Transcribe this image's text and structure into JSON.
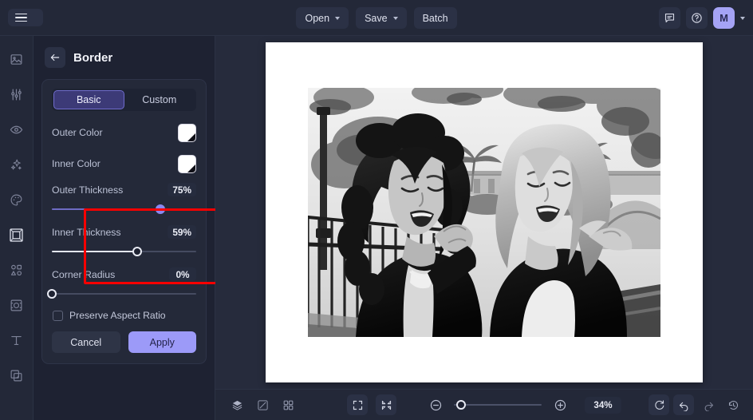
{
  "app": {
    "title": "Photo Editor",
    "accent": "#9c9af8",
    "panel_bg": "#1e2232",
    "annotation_color": "#f60000"
  },
  "topbar": {
    "menu_icon": "hamburger-icon",
    "open_label": "Open",
    "save_label": "Save",
    "batch_label": "Batch",
    "comment_icon": "comment-icon",
    "help_icon": "help-circle-icon",
    "avatar_initial": "M"
  },
  "sidebar": {
    "items": [
      {
        "name": "image",
        "icon": "image-icon",
        "active": false
      },
      {
        "name": "adjust",
        "icon": "sliders-icon",
        "active": false
      },
      {
        "name": "retouch",
        "icon": "eye-icon",
        "active": false
      },
      {
        "name": "effects",
        "icon": "sparkles-icon",
        "active": false
      },
      {
        "name": "color",
        "icon": "palette-icon",
        "active": false
      },
      {
        "name": "border",
        "icon": "border-icon",
        "active": true
      },
      {
        "name": "shapes",
        "icon": "shapes-icon",
        "active": false
      },
      {
        "name": "crop",
        "icon": "frame-icon",
        "active": false
      },
      {
        "name": "text",
        "icon": "text-icon",
        "active": false
      },
      {
        "name": "layers",
        "icon": "layers-copy-icon",
        "active": false
      }
    ]
  },
  "panel": {
    "back_icon": "arrow-left-icon",
    "title": "Border",
    "tabs": [
      {
        "label": "Basic",
        "active": true
      },
      {
        "label": "Custom",
        "active": false
      }
    ],
    "outer_color": {
      "label": "Outer Color",
      "value": "#ffffff"
    },
    "inner_color": {
      "label": "Inner Color",
      "value": "#ffffff"
    },
    "outer_thickness": {
      "label": "Outer Thickness",
      "value": 75,
      "display": "75%"
    },
    "inner_thickness": {
      "label": "Inner Thickness",
      "value": 59,
      "display": "59%"
    },
    "corner_radius": {
      "label": "Corner Radius",
      "value": 0,
      "display": "0%"
    },
    "preserve_aspect": {
      "label": "Preserve Aspect Ratio",
      "checked": false
    },
    "cancel_label": "Cancel",
    "apply_label": "Apply"
  },
  "canvas": {
    "border_color": "#ffffff",
    "photo_alt": "Two women laughing outdoors, black and white"
  },
  "bottombar": {
    "left_icons": [
      {
        "name": "layers-icon"
      },
      {
        "name": "compare-icon"
      },
      {
        "name": "grid-icon"
      }
    ],
    "fit_icon": "fit-screen-icon",
    "shrink_icon": "shrink-icon",
    "zoom_out_icon": "zoom-out-icon",
    "zoom_in_icon": "zoom-in-icon",
    "zoom_value": 34,
    "zoom_display": "34%",
    "right_icons": [
      {
        "name": "rotate-icon",
        "boxed": true,
        "dim": false
      },
      {
        "name": "undo-icon",
        "boxed": true,
        "dim": false
      },
      {
        "name": "redo-icon",
        "boxed": false,
        "dim": true
      },
      {
        "name": "history-icon",
        "boxed": false,
        "dim": false
      }
    ]
  }
}
